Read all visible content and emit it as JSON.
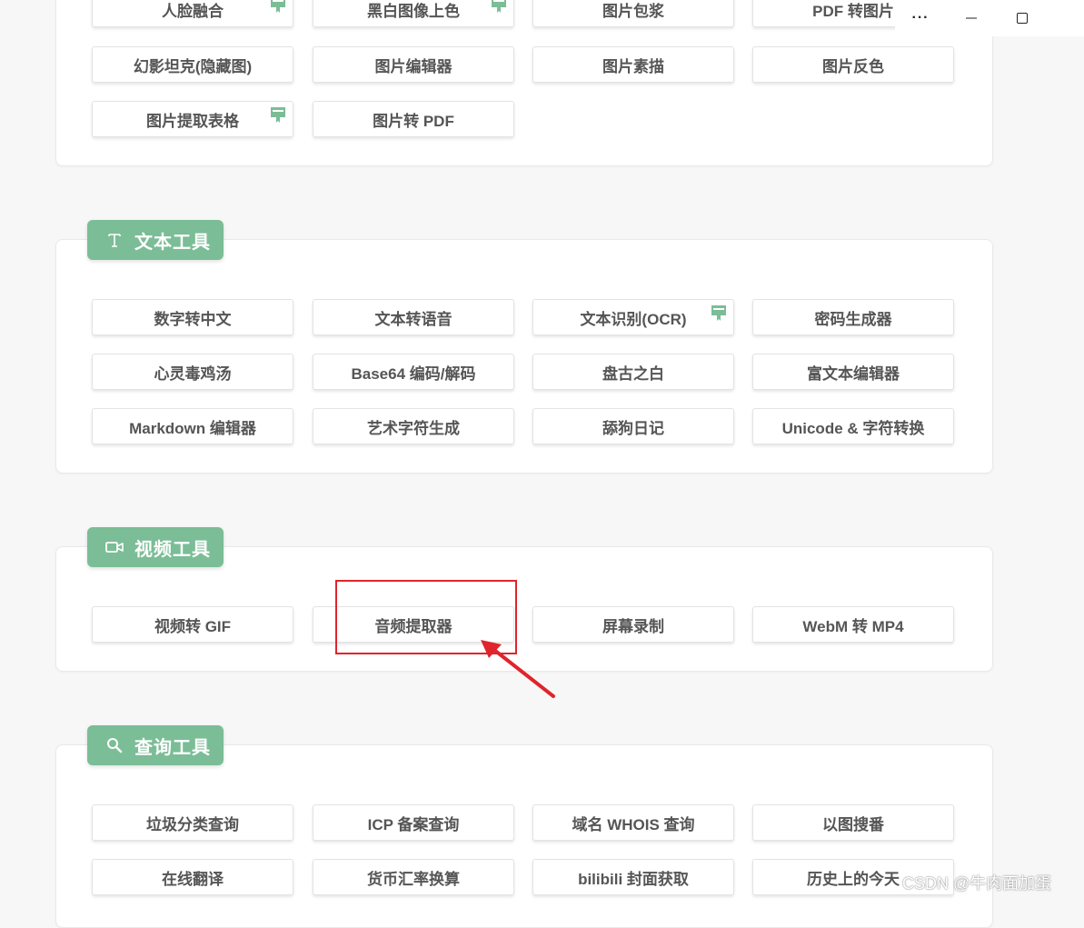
{
  "colors": {
    "accent": "#7bbd96",
    "highlight": "#e0242b"
  },
  "window_controls": {
    "more_label": "···"
  },
  "image_tools": {
    "items": [
      {
        "label": "人脸融合",
        "flag": true
      },
      {
        "label": "黑白图像上色",
        "flag": true
      },
      {
        "label": "图片包浆",
        "flag": false
      },
      {
        "label": "PDF 转图片",
        "flag": false
      },
      {
        "label": "幻影坦克(隐藏图)",
        "flag": false
      },
      {
        "label": "图片编辑器",
        "flag": false
      },
      {
        "label": "图片素描",
        "flag": false
      },
      {
        "label": "图片反色",
        "flag": false
      },
      {
        "label": "图片提取表格",
        "flag": true
      },
      {
        "label": "图片转 PDF",
        "flag": false
      }
    ]
  },
  "text_tools": {
    "title": "文本工具",
    "icon": "text-T-icon",
    "items": [
      {
        "label": "数字转中文",
        "flag": false
      },
      {
        "label": "文本转语音",
        "flag": false
      },
      {
        "label": "文本识别(OCR)",
        "flag": true
      },
      {
        "label": "密码生成器",
        "flag": false
      },
      {
        "label": "心灵毒鸡汤",
        "flag": false
      },
      {
        "label": "Base64 编码/解码",
        "flag": false
      },
      {
        "label": "盘古之白",
        "flag": false
      },
      {
        "label": "富文本编辑器",
        "flag": false
      },
      {
        "label": "Markdown 编辑器",
        "flag": false
      },
      {
        "label": "艺术字符生成",
        "flag": false
      },
      {
        "label": "舔狗日记",
        "flag": false
      },
      {
        "label": "Unicode & 字符转换",
        "flag": false
      }
    ]
  },
  "video_tools": {
    "title": "视频工具",
    "icon": "video-camera-icon",
    "items": [
      {
        "label": "视频转 GIF",
        "flag": false
      },
      {
        "label": "音频提取器",
        "flag": false
      },
      {
        "label": "屏幕录制",
        "flag": false
      },
      {
        "label": "WebM 转 MP4",
        "flag": false
      }
    ]
  },
  "query_tools": {
    "title": "查询工具",
    "icon": "search-icon",
    "items": [
      {
        "label": "垃圾分类查询",
        "flag": false
      },
      {
        "label": "ICP 备案查询",
        "flag": false
      },
      {
        "label": "域名 WHOIS 查询",
        "flag": false
      },
      {
        "label": "以图搜番",
        "flag": false
      },
      {
        "label": "在线翻译",
        "flag": false
      },
      {
        "label": "货币汇率换算",
        "flag": false
      },
      {
        "label": "bilibili 封面获取",
        "flag": false
      },
      {
        "label": "历史上的今天",
        "flag": false
      }
    ]
  },
  "watermark": "CSDN @牛肉面加蛋"
}
